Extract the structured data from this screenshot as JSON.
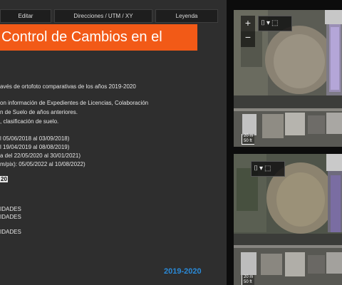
{
  "toolbar": {
    "items": [
      {
        "label": "Editar"
      },
      {
        "label": "Direcciones / UTM / XY"
      },
      {
        "label": "Leyenda"
      }
    ]
  },
  "banner": {
    "title": "Control de Cambios en el"
  },
  "content": {
    "subtitle": "avés de ortofoto comparativas de los años 2019-2020",
    "desc_line1": "on información de Expedientes de Licencias, Colaboración",
    "desc_line2": "n de Suelo de años anteriores.",
    "desc_line3": ", clasificación de suelo.",
    "date_line1": "l 05/06/2018 al 03/09/2018)",
    "date_line2": "l 19/04/2019 al 08/08/2019)",
    "date_line3": "a del 22/05/2020 al 30/01/2021)",
    "date_line4": "m/pix): 05/05/2022 al 10/08/2022)",
    "pill_text": "20",
    "list_item1": "IDADES",
    "list_item2": "IDADES",
    "list_item3": "IDADES",
    "year_link": "2019-2020"
  },
  "map_top": {
    "zoom_in": "+",
    "zoom_out": "−",
    "scale_m": "20 m",
    "scale_ft": "50 ft"
  },
  "map_bottom": {
    "scale_m": "20 m",
    "scale_ft": "50 ft"
  },
  "map_tools": {
    "swipe_icon": "⌷",
    "dropdown_icon": "▾",
    "select_icon": "⬚"
  },
  "colors": {
    "panel_bg": "#2e2e2e",
    "banner_bg": "#f25a17",
    "link_blue": "#2a8ad8",
    "page_bg": "#0c0c0c"
  }
}
